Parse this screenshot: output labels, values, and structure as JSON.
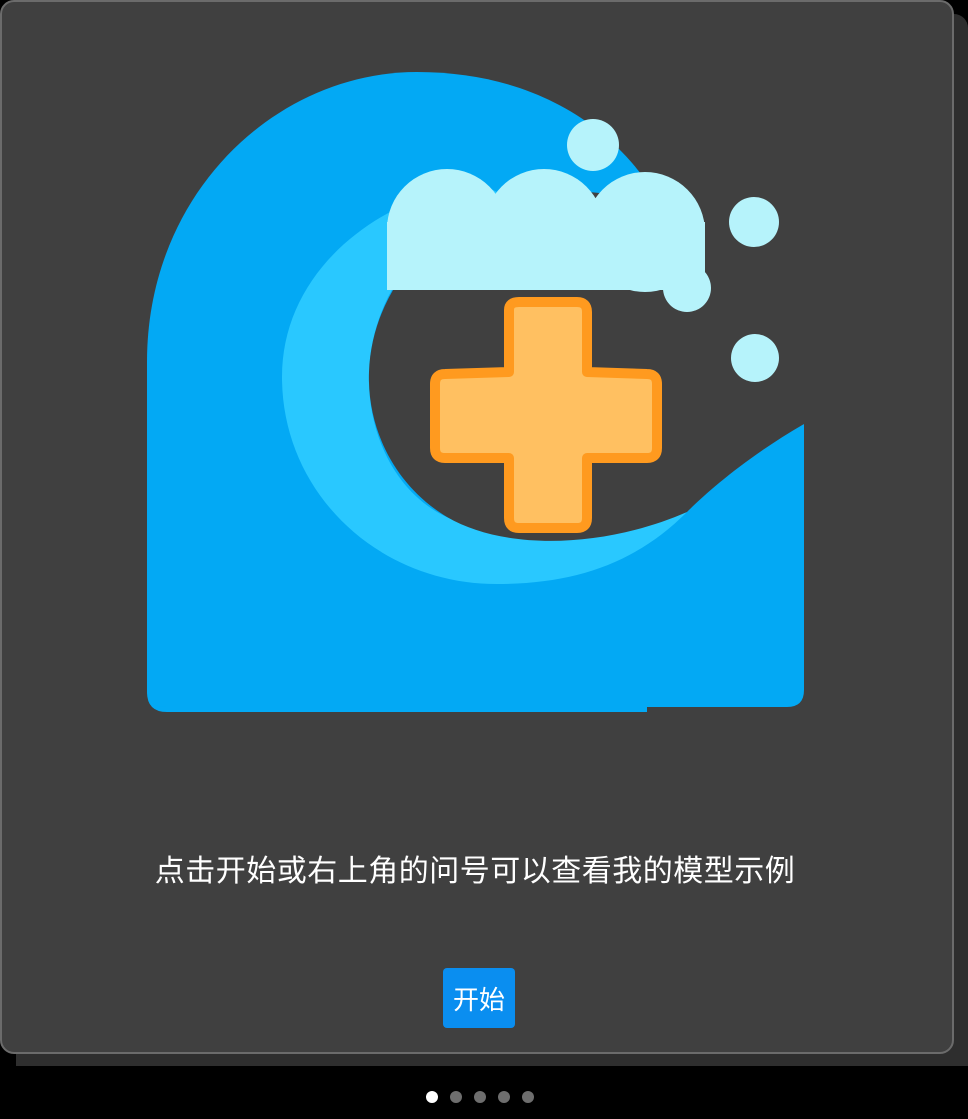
{
  "onboarding": {
    "message": "点击开始或右上角的问号可以查看我的模型示例",
    "start_label": "开始",
    "hero_icon": "wave-plus-logo-icon"
  },
  "pager": {
    "total": 5,
    "active_index": 0
  },
  "colors": {
    "card_background": "#404040",
    "accent_button": "#0a8ef0",
    "wave_blue": "#03a9f4",
    "wave_light": "#29c8ff",
    "foam": "#b6f3fb",
    "plus_fill": "#ffc061",
    "plus_stroke": "#ff9a1f"
  }
}
